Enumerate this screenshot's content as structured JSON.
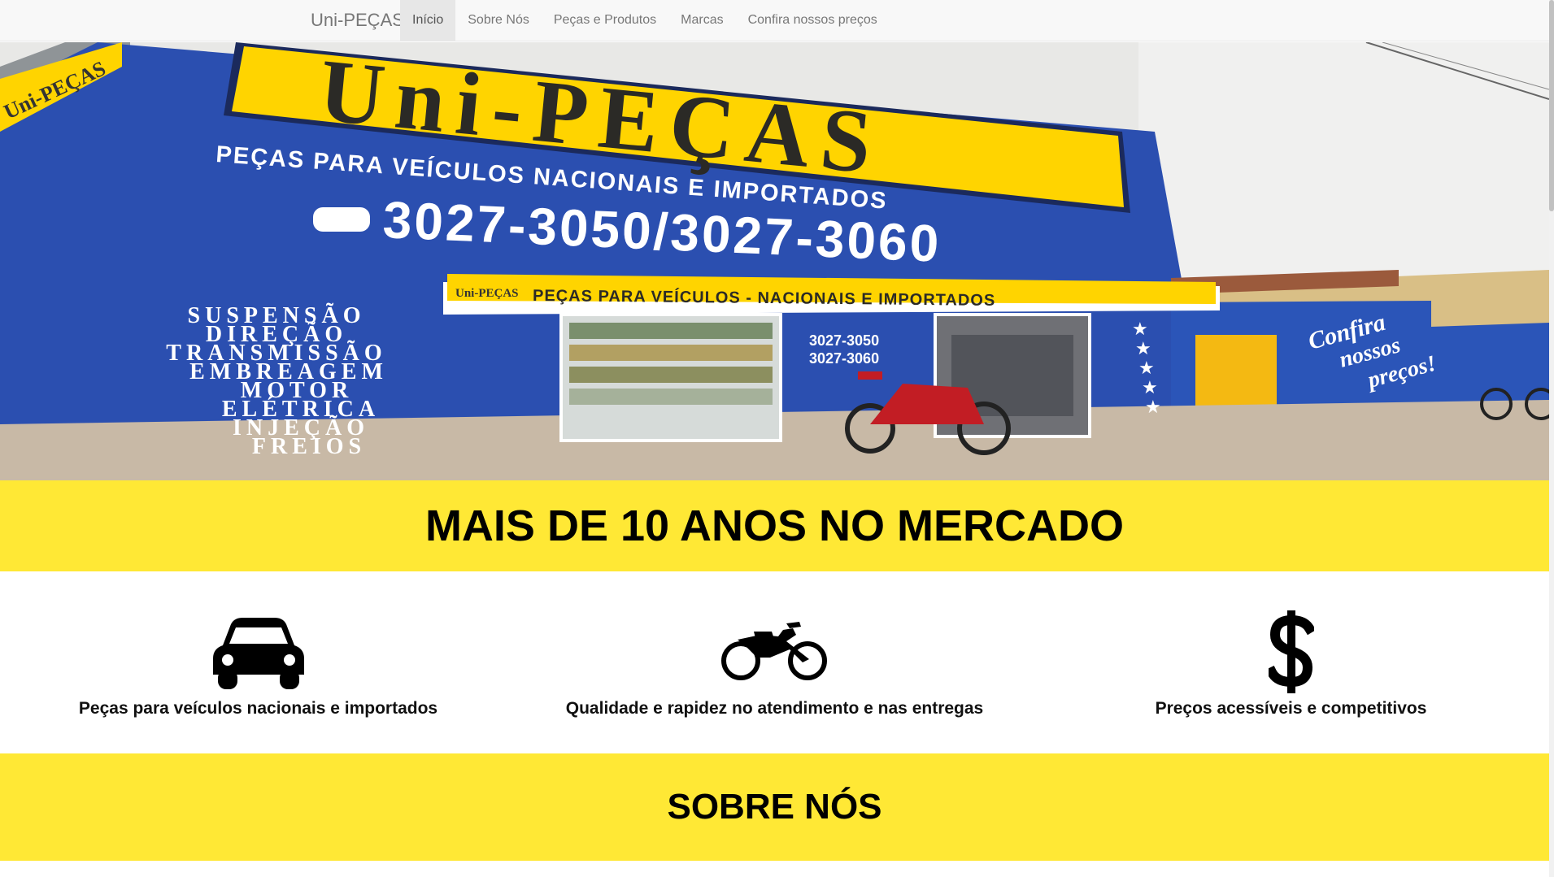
{
  "navbar": {
    "brand": "Uni-PEÇAS",
    "items": [
      {
        "label": "Início",
        "active": true
      },
      {
        "label": "Sobre Nós",
        "active": false
      },
      {
        "label": "Peças e Produtos",
        "active": false
      },
      {
        "label": "Marcas",
        "active": false
      },
      {
        "label": "Confira nossos preços",
        "active": false
      }
    ]
  },
  "hero": {
    "sign_title": "Uni-PEÇAS",
    "sign_subtitle": "PEÇAS PARA VEÍCULOS NACIONAIS E IMPORTADOS",
    "sign_phones": "3027-3050/3027-3060",
    "awning_brand": "Uni-PEÇAS",
    "awning_text": "PEÇAS PARA VEÍCULOS - NACIONAIS E IMPORTADOS",
    "wall_phone_1": "3027-3050",
    "wall_phone_2": "3027-3060",
    "services": [
      "SUSPENSÃO",
      "DIREÇÃO",
      "TRANSMISSÃO",
      "EMBREAGEM",
      "MOTOR",
      "ELÉTRICA",
      "INJEÇÃO",
      "FREIOS"
    ],
    "slogan_1": "Confira",
    "slogan_2": "nossos",
    "slogan_3": "preços!",
    "side_sign": "Uni-PEÇAS"
  },
  "headline": "MAIS DE 10 ANOS NO MERCADO",
  "features": [
    {
      "icon": "car-icon",
      "text": "Peças para veículos nacionais e importados"
    },
    {
      "icon": "motorcycle-icon",
      "text": "Qualidade e rapidez no atendimento e nas entregas"
    },
    {
      "icon": "dollar-icon",
      "text": "Preços acessíveis e competitivos"
    }
  ],
  "section_title": "SOBRE NÓS",
  "colors": {
    "accent_yellow": "#ffe835",
    "wall_blue": "#2b4fb0",
    "sign_yellow": "#ffd400"
  }
}
